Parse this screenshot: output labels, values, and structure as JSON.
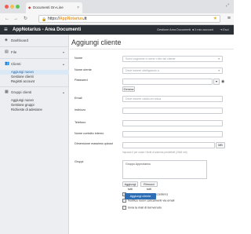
{
  "browser": {
    "tab_title": "Documenti On-Line",
    "url_prefix": "https://",
    "url_domain": "AppNotarius",
    "url_suffix": ".it",
    "url_brand_mid": "",
    "colors": {
      "red": "#ee5f57",
      "yellow": "#f5be4f",
      "green": "#5fc454"
    }
  },
  "app": {
    "title": "AppNotarius - Area Documenti",
    "topnav": [
      {
        "label": "Gestione Area Documenti"
      },
      {
        "label": "Il mio account"
      },
      {
        "label": "Esci"
      }
    ],
    "accent": "#2d6db3",
    "header_bg": "#2b2f36"
  },
  "sidebar": {
    "dashboard": "Dashboard",
    "groups": [
      {
        "label": "File",
        "items": []
      },
      {
        "label": "Clienti",
        "items": [
          "Aggiungi nuovo",
          "Gestione clienti",
          "Registri account"
        ]
      },
      {
        "label": "Gruppi clienti",
        "items": [
          "Aggiungi nuovo",
          "Gestione gruppi",
          "Richieste di adesione"
        ]
      }
    ]
  },
  "form": {
    "page_title": "Aggiungi cliente",
    "fields": {
      "nome_label": "Nome",
      "nome_placeholder": "Scrivi cognome e nome o tite del cliente",
      "nome_utente_label": "Nome utente",
      "nome_utente_placeholder": "Deve essere obbligatorio a",
      "password_label": "Password",
      "genera_label": "Genera",
      "email_label": "Email",
      "email_placeholder": "Deve essere valido ed unica",
      "indirizzo_label": "Indirizzo",
      "telefono_label": "Telefono",
      "nome_contatto_label": "Nome contatto interno",
      "dimensione_label": "Dimensione massima upload",
      "dimensione_unit": "MB",
      "dimensione_hint": "Imposta 0 per usare i limiti di sistema predefiniti (2048 mb)",
      "gruppi_label": "Gruppi",
      "gruppi_value": "Gruppo Appnotarius",
      "aggiungi_tutti": "Aggiungi tutti",
      "rimuovi_tutti": "Rimuovi tutti"
    },
    "checkboxes": [
      {
        "label": "Attivo (il cliente può accedere)",
        "checked": true
      },
      {
        "label": "Notifica nuovi caricamenti via email",
        "checked": true
      },
      {
        "label": "Invia la mail di benvenuto",
        "checked": true
      }
    ],
    "submit_label": "Aggiungi cliente"
  }
}
